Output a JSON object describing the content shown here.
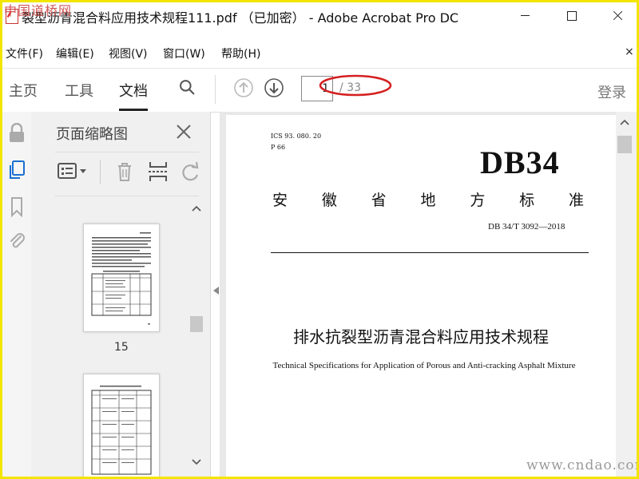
{
  "watermark": {
    "top": "中国道桥网",
    "bottom": "www.cndao.com"
  },
  "window": {
    "title": "裂型沥青混合料应用技术规程111.pdf （已加密） - Adobe Acrobat Pro DC"
  },
  "menu": {
    "items": [
      {
        "label": "文件(F)"
      },
      {
        "label": "编辑(E)"
      },
      {
        "label": "视图(V)"
      },
      {
        "label": "窗口(W)"
      },
      {
        "label": "帮助(H)"
      }
    ],
    "close_label": "×"
  },
  "toolbar": {
    "tabs": [
      {
        "label": "主页"
      },
      {
        "label": "工具"
      },
      {
        "label": "文档"
      }
    ],
    "page_current": "1",
    "page_total": "/ 33",
    "login_label": "登录"
  },
  "thumbnail_panel": {
    "title": "页面缩略图",
    "pages": [
      {
        "label": "15"
      },
      {
        "label": ""
      }
    ]
  },
  "document": {
    "ics": "ICS 93. 080. 20",
    "p": "P 66",
    "big_title": "DB34",
    "province_chars": [
      "安",
      "徽",
      "省",
      "地",
      "方",
      "标",
      "准"
    ],
    "code": "DB 34/T  3092—2018",
    "title_cn": "排水抗裂型沥青混合料应用技术规程",
    "title_en": "Technical Specifications for Application of Porous and Anti-cracking Asphalt Mixture"
  },
  "colors": {
    "highlight_ellipse": "#d42020",
    "frame": "#f2e600"
  }
}
